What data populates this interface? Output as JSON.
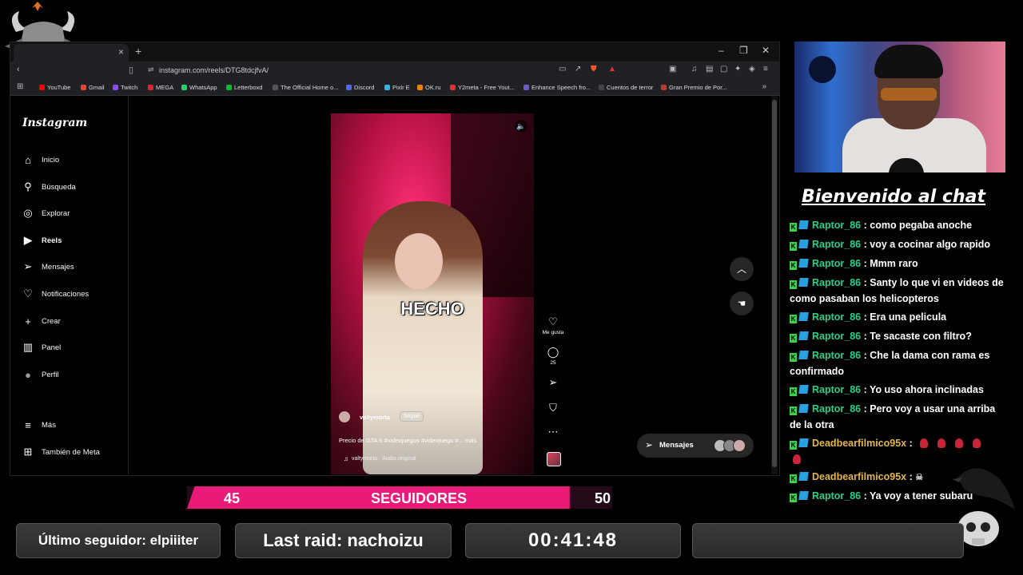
{
  "browser": {
    "url": "instagram.com/reels/DTG8tdcjfvA/",
    "new_tab_symbol": "+",
    "tab_close_symbol": "×",
    "window_controls": [
      "–",
      "❐",
      "✕"
    ],
    "bookmarks": [
      {
        "label": "YouTube",
        "color": "#ff0000"
      },
      {
        "label": "Gmail",
        "color": "#ea4335"
      },
      {
        "label": "Twitch",
        "color": "#9146ff"
      },
      {
        "label": "MEGA",
        "color": "#d9272e"
      },
      {
        "label": "WhatsApp",
        "color": "#25d366"
      },
      {
        "label": "Letterboxd",
        "color": "#00c030"
      },
      {
        "label": "The Official Home o...",
        "color": "#555555"
      },
      {
        "label": "Discord",
        "color": "#5865f2"
      },
      {
        "label": "Pixlr E",
        "color": "#2fb5e6"
      },
      {
        "label": "OK.ru",
        "color": "#ee8208"
      },
      {
        "label": "Y2meta - Free Yout...",
        "color": "#e03030"
      },
      {
        "label": "Enhance Speech fro...",
        "color": "#6a5acd"
      },
      {
        "label": "Cuentos de terror",
        "color": "#444444"
      },
      {
        "label": "Gran Premio de Por...",
        "color": "#c0392b"
      }
    ]
  },
  "instagram": {
    "logo": "Instagram",
    "nav": [
      {
        "label": "Inicio",
        "icon": "home-icon",
        "glyph": "⌂"
      },
      {
        "label": "Búsqueda",
        "icon": "search-icon",
        "glyph": "⚲"
      },
      {
        "label": "Explorar",
        "icon": "compass-icon",
        "glyph": "◎"
      },
      {
        "label": "Reels",
        "icon": "reels-icon",
        "glyph": "▶"
      },
      {
        "label": "Mensajes",
        "icon": "send-icon",
        "glyph": "➢"
      },
      {
        "label": "Notificaciones",
        "icon": "heart-icon",
        "glyph": "♡"
      },
      {
        "label": "Crear",
        "icon": "plus-icon",
        "glyph": "+"
      },
      {
        "label": "Panel",
        "icon": "chart-icon",
        "glyph": "▥"
      },
      {
        "label": "Perfil",
        "icon": "avatar-icon",
        "glyph": "●"
      },
      {
        "label": "Más",
        "icon": "menu-icon",
        "glyph": "≡"
      },
      {
        "label": "También de Meta",
        "icon": "meta-icon",
        "glyph": "⊞"
      }
    ],
    "active_nav": "Reels",
    "reel": {
      "caption_overlay": "HECHO",
      "username": "valtymorta",
      "follow_label": "Seguir",
      "description": "Precio de GTA 6 #videojuegos #videojuego #... más",
      "audio": "valtymorta · Audio original",
      "likes_label": "Me gusta",
      "comments_count": "25"
    },
    "messages_label": "Mensajes"
  },
  "overlay": {
    "chat_title": "Bienvenido al chat",
    "chat": [
      {
        "user": "Raptor_86",
        "text": "como pegaba anoche",
        "gold": false
      },
      {
        "user": "Raptor_86",
        "text": "voy a cocinar algo rapido",
        "gold": false
      },
      {
        "user": "Raptor_86",
        "text": "Mmm raro",
        "gold": false
      },
      {
        "user": "Raptor_86",
        "text": "Santy lo que vi en videos de como pasaban los helicopteros",
        "gold": false
      },
      {
        "user": "Raptor_86",
        "text": "Era una pelicula",
        "gold": false
      },
      {
        "user": "Raptor_86",
        "text": "Te sacaste con filtro?",
        "gold": false
      },
      {
        "user": "Raptor_86",
        "text": "Che la dama con rama es confirmado",
        "gold": false
      },
      {
        "user": "Raptor_86",
        "text": "Yo uso ahora inclinadas",
        "gold": false
      },
      {
        "user": "Raptor_86",
        "text": "Pero voy a usar una arriba de la otra",
        "gold": false
      },
      {
        "user": "Deadbearfilmico95x",
        "text": "",
        "gold": true,
        "roses": 5
      },
      {
        "user": "Deadbearfilmico95x",
        "text": "",
        "gold": true,
        "emote": true
      },
      {
        "user": "Raptor_86",
        "text": "Ya voy a tener subaru",
        "gold": false
      }
    ],
    "followers": {
      "current": "45",
      "label": "SEGUIDORES",
      "goal": "50",
      "progress": 0.9
    },
    "panels": {
      "last_follower": "Último seguidor: elpiiiter",
      "last_raid": "Last raid: nachoizu",
      "timer": "00:41:48",
      "empty": ""
    },
    "colors": {
      "accent": "#ea1a78",
      "user_green": "#23d18b",
      "user_gold": "#e2b64a"
    }
  }
}
